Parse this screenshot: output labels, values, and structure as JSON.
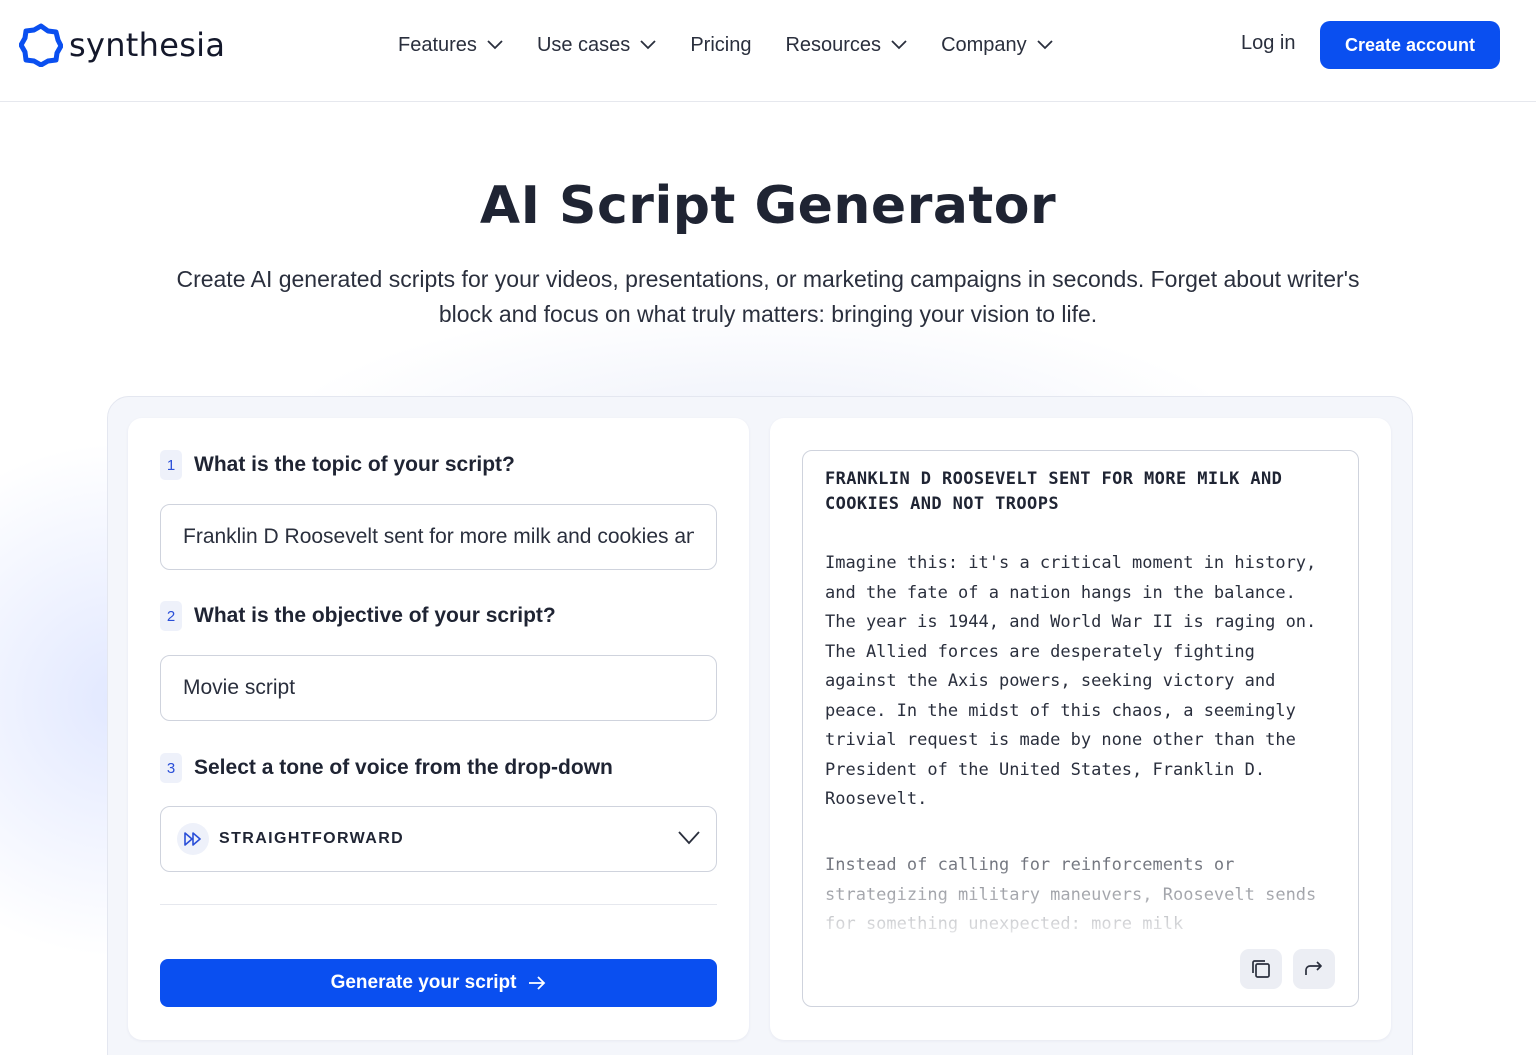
{
  "brand": {
    "name": "synthesia",
    "accent": "#0a4ff0"
  },
  "nav": {
    "items": [
      {
        "label": "Features",
        "has_dropdown": true
      },
      {
        "label": "Use cases",
        "has_dropdown": true
      },
      {
        "label": "Pricing",
        "has_dropdown": false
      },
      {
        "label": "Resources",
        "has_dropdown": true
      },
      {
        "label": "Company",
        "has_dropdown": true
      }
    ],
    "login_label": "Log in",
    "cta_label": "Create account"
  },
  "hero": {
    "title": "AI Script Generator",
    "subtitle": "Create AI generated scripts for your videos, presentations, or marketing campaigns in seconds. Forget about writer's block and focus on what truly matters: bringing your vision to life."
  },
  "form": {
    "q1": {
      "num": "1",
      "label": "What is the topic of your script?",
      "value": "Franklin D Roosevelt sent for more milk and cookies and not troops"
    },
    "q2": {
      "num": "2",
      "label": "What is the objective of your script?",
      "value": "Movie script"
    },
    "q3": {
      "num": "3",
      "label": "Select a tone of voice from the drop-down",
      "selected": "STRAIGHTFORWARD",
      "icon": "fast-forward-icon"
    },
    "generate_label": "Generate your script"
  },
  "output": {
    "title": "FRANKLIN D ROOSEVELT SENT FOR MORE MILK AND COOKIES AND NOT TROOPS",
    "paragraph1": "Imagine this: it's a critical moment in history, and the fate of a nation hangs in the balance. The year is 1944, and World War II is raging on. The Allied forces are desperately fighting against the Axis powers, seeking victory and peace. In the midst of this chaos, a seemingly trivial request is made by none other than the President of the United States, Franklin D. Roosevelt.",
    "paragraph2": "Instead of calling for reinforcements or strategizing military maneuvers, Roosevelt sends for something unexpected: more milk",
    "actions": [
      "copy-icon",
      "share-icon"
    ]
  }
}
